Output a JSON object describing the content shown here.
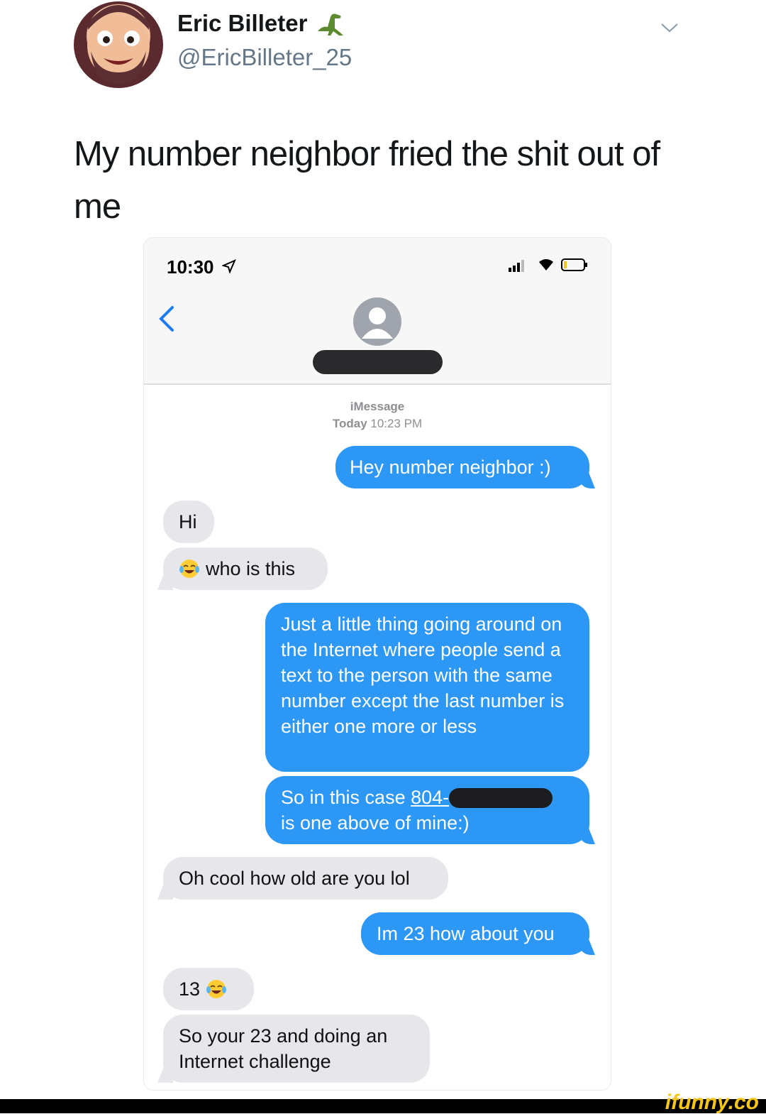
{
  "tweet": {
    "author_name": "Eric Billeter",
    "author_emoji": "dinosaur-icon",
    "author_handle": "@EricBilleter_25",
    "text": "My number neighbor fried the shit out of me"
  },
  "phone": {
    "status_time": "10:30",
    "header": {
      "service": "iMessage",
      "date_label": "Today",
      "time_label": "10:23 PM"
    },
    "messages": [
      {
        "dir": "out",
        "text": "Hey number neighbor :)"
      },
      {
        "dir": "in",
        "text": "Hi"
      },
      {
        "dir": "in",
        "emoji": "tears-of-joy-icon",
        "text": "who is this"
      },
      {
        "dir": "out",
        "text": "Just a little thing going around on the Internet where people send a text to the person with the same number except the last number is either one more or less"
      },
      {
        "dir": "out",
        "text_before": "So in this case ",
        "link": "804-",
        "text_after": "is one above of mine:)"
      },
      {
        "dir": "in",
        "text": "Oh cool how old are you lol"
      },
      {
        "dir": "out",
        "text": "Im 23 how about you"
      },
      {
        "dir": "in",
        "text": "13",
        "emoji": "tears-of-joy-icon"
      },
      {
        "dir": "in",
        "text": "So your 23 and doing an Internet challenge"
      }
    ]
  },
  "watermark": "ifunny.co",
  "colors": {
    "outgoing": "#2d97f5",
    "incoming": "#e6e6eb",
    "watermark": "#f5c518"
  }
}
